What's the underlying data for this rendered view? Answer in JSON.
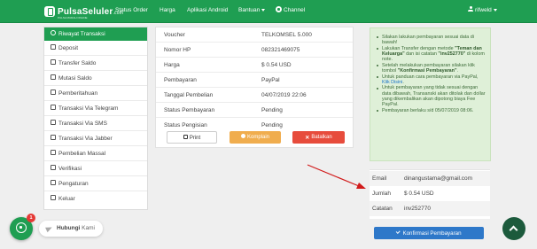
{
  "brand": {
    "name": "PulsaSeluler",
    "suffix": ".com",
    "tagline": "PULSA MURAH ONLINE"
  },
  "nav": {
    "status_order": "Status Order",
    "harga": "Harga",
    "aplikasi_android": "Aplikasi Android",
    "bantuan": "Bantuan",
    "channel": "Channel",
    "user": "rifweld"
  },
  "sidebar": {
    "items": [
      {
        "label": "Riwayat Transaksi",
        "icon": "history-icon",
        "active": true
      },
      {
        "label": "Deposit",
        "icon": "deposit-icon"
      },
      {
        "label": "Transfer Saldo",
        "icon": "transfer-icon"
      },
      {
        "label": "Mutasi Saldo",
        "icon": "mutasi-icon"
      },
      {
        "label": "Pemberitahuan",
        "icon": "bell-icon"
      },
      {
        "label": "Transaksi Via Telegram",
        "icon": "telegram-icon"
      },
      {
        "label": "Transaksi Via SMS",
        "icon": "sms-icon"
      },
      {
        "label": "Transaksi Via Jabber",
        "icon": "chat-icon"
      },
      {
        "label": "Pembelian Massal",
        "icon": "cart-icon"
      },
      {
        "label": "Verifikasi",
        "icon": "check-icon"
      },
      {
        "label": "Pengaturan",
        "icon": "gear-icon"
      },
      {
        "label": "Keluar",
        "icon": "logout-icon"
      }
    ]
  },
  "details": {
    "rows": [
      {
        "label": "Voucher",
        "value": "TELKOMSEL 5.000"
      },
      {
        "label": "Nomor HP",
        "value": "082321469075"
      },
      {
        "label": "Harga",
        "value": "$ 0.54 USD"
      },
      {
        "label": "Pembayaran",
        "value": "PayPal"
      },
      {
        "label": "Tanggal Pembelian",
        "value": "04/07/2019 22:06"
      },
      {
        "label": "Status Pembayaran",
        "value": "Pending"
      },
      {
        "label": "Status Pengisian",
        "value": "Pending"
      }
    ],
    "buttons": {
      "print": "Print",
      "komplain": "Komplain",
      "batalkan": "Batalkan"
    }
  },
  "instructions": {
    "i1": "Silakan lakukan pembayaran sesuai data di bawah!",
    "i2_pre": "Lakukan Transfer dengan metode ",
    "i2_b1": "\"Teman dan Keluarga\"",
    "i2_mid": " dan isi catatan ",
    "i2_b2": "\"inv252770\"",
    "i2_post": " di kolom note.",
    "i3_pre": "Setelah melakukan pembayaran silakan klik tombol ",
    "i3_b": "\"Konfirmasi Pembayaran\"",
    "i3_post": ".",
    "i4_pre": "Untuk panduan cara pembayaran via PayPal, ",
    "i4_link": "Klik Disini",
    "i4_post": ".",
    "i5": "Untuk pembayaran yang tidak sesuai dengan data dibawah, Transanski akan ditolak dan dollar yang dikembalikan akan dipotong biaya Fee PayPal.",
    "i6": "Pembayaran berlaku s/d 05/07/2019 08:06."
  },
  "payment": {
    "rows": [
      {
        "label": "Email",
        "value": "dinangustama@gmail.com"
      },
      {
        "label": "Jumlah",
        "value": "$ 0.54 USD"
      },
      {
        "label": "Catatan",
        "value": "inv252770"
      }
    ],
    "confirm_label": "Konfirmasi Pembayaran"
  },
  "whatsapp": {
    "badge": "1",
    "hubungi": "Hubungi",
    "kami": "Kami"
  },
  "colors": {
    "brand_green": "#1f9e52",
    "confirm_blue": "#2e78c9",
    "komplain_orange": "#f0ad4e",
    "batal_red": "#e74c3c",
    "annotation_red": "#d11a1a"
  }
}
